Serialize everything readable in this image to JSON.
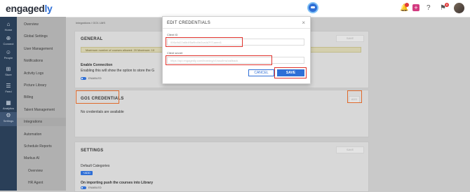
{
  "brand": {
    "name_prefix": "engaged",
    "name_suffix": "ly"
  },
  "topbar": {
    "plus_label": "+",
    "notif_count": "8"
  },
  "rail": [
    {
      "label": "Home",
      "icon": "home-icon",
      "glyph": "⌂"
    },
    {
      "label": "Connect",
      "icon": "connect-icon",
      "glyph": "⊕"
    },
    {
      "label": "People",
      "icon": "people-icon",
      "glyph": "☺"
    },
    {
      "label": "Store",
      "icon": "store-icon",
      "glyph": "⊞"
    },
    {
      "label": "Feed",
      "icon": "feed-icon",
      "glyph": "☰"
    },
    {
      "label": "Analytics",
      "icon": "analytics-icon",
      "glyph": "▦"
    },
    {
      "label": "Settings",
      "icon": "settings-icon",
      "glyph": "⚙"
    }
  ],
  "subnav": [
    "Overview",
    "Global Settings",
    "User Management",
    "Notifications",
    "Activity Logs",
    "Picture Library",
    "Billing",
    "Talent Management",
    "Integrations",
    "Automation",
    "Schedule Reports",
    "Markus AI",
    "Overview",
    "HR Agent"
  ],
  "breadcrumb": "Integrations  /  GO1 LMS",
  "general": {
    "title": "GENERAL",
    "button": "SAVE",
    "notice": "Maximum number of courses allowed: 20   Maximum: 10",
    "enable_title": "Enable Connection",
    "enable_desc": "Enabling this will show the option to store the G",
    "toggle_label": "ENABLED"
  },
  "credentials": {
    "title": "GO1 CREDENTIALS",
    "add": "ADD",
    "empty": "No credentials are available"
  },
  "settings": {
    "title": "SETTINGS",
    "button": "SAVE",
    "default_categories": "Default Categories",
    "chip": "+ADD",
    "push_label": "On importing push the courses into Library",
    "toggle_label": "ENABLED"
  },
  "modal": {
    "title": "EDIT CREDENTIALS",
    "close": "×",
    "client_id_label": "Client ID",
    "client_id_value": "006c9d22a6b4f5a9bd4e2ca4d7f71aeed1",
    "client_secret_label": "Client secret",
    "client_secret_value": "https://api.engagedly.com/learning/v1/sso/lms/callback",
    "cancel": "CANCEL",
    "save": "SAVE"
  }
}
